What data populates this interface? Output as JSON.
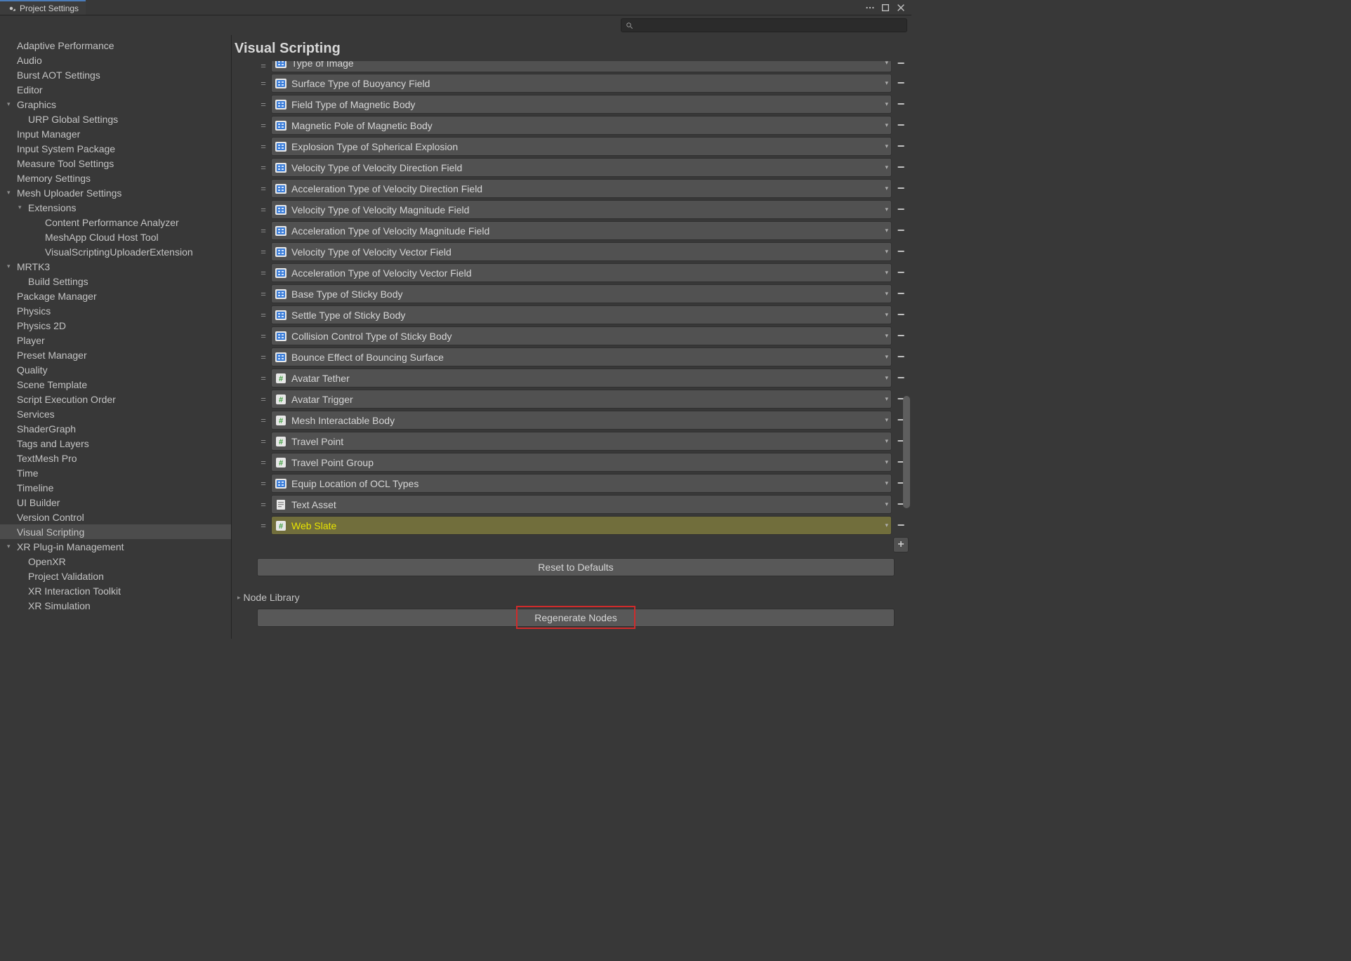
{
  "window": {
    "title": "Project Settings"
  },
  "search": {
    "placeholder": ""
  },
  "sidebar": {
    "items": [
      {
        "label": "Adaptive Performance",
        "indent": 0,
        "toggle": false
      },
      {
        "label": "Audio",
        "indent": 0,
        "toggle": false
      },
      {
        "label": "Burst AOT Settings",
        "indent": 0,
        "toggle": false
      },
      {
        "label": "Editor",
        "indent": 0,
        "toggle": false
      },
      {
        "label": "Graphics",
        "indent": 0,
        "toggle": true,
        "open": true
      },
      {
        "label": "URP Global Settings",
        "indent": 1,
        "toggle": false
      },
      {
        "label": "Input Manager",
        "indent": 0,
        "toggle": false
      },
      {
        "label": "Input System Package",
        "indent": 0,
        "toggle": false
      },
      {
        "label": "Measure Tool Settings",
        "indent": 0,
        "toggle": false
      },
      {
        "label": "Memory Settings",
        "indent": 0,
        "toggle": false
      },
      {
        "label": "Mesh Uploader Settings",
        "indent": 0,
        "toggle": true,
        "open": true
      },
      {
        "label": "Extensions",
        "indent": 1,
        "toggle": true,
        "open": true
      },
      {
        "label": "Content Performance Analyzer",
        "indent": 2,
        "toggle": false
      },
      {
        "label": "MeshApp Cloud Host Tool",
        "indent": 2,
        "toggle": false
      },
      {
        "label": "VisualScriptingUploaderExtension",
        "indent": 2,
        "toggle": false
      },
      {
        "label": "MRTK3",
        "indent": 0,
        "toggle": true,
        "open": true
      },
      {
        "label": "Build Settings",
        "indent": 1,
        "toggle": false
      },
      {
        "label": "Package Manager",
        "indent": 0,
        "toggle": false
      },
      {
        "label": "Physics",
        "indent": 0,
        "toggle": false
      },
      {
        "label": "Physics 2D",
        "indent": 0,
        "toggle": false
      },
      {
        "label": "Player",
        "indent": 0,
        "toggle": false
      },
      {
        "label": "Preset Manager",
        "indent": 0,
        "toggle": false
      },
      {
        "label": "Quality",
        "indent": 0,
        "toggle": false
      },
      {
        "label": "Scene Template",
        "indent": 0,
        "toggle": false
      },
      {
        "label": "Script Execution Order",
        "indent": 0,
        "toggle": false
      },
      {
        "label": "Services",
        "indent": 0,
        "toggle": false
      },
      {
        "label": "ShaderGraph",
        "indent": 0,
        "toggle": false
      },
      {
        "label": "Tags and Layers",
        "indent": 0,
        "toggle": false
      },
      {
        "label": "TextMesh Pro",
        "indent": 0,
        "toggle": false
      },
      {
        "label": "Time",
        "indent": 0,
        "toggle": false
      },
      {
        "label": "Timeline",
        "indent": 0,
        "toggle": false
      },
      {
        "label": "UI Builder",
        "indent": 0,
        "toggle": false
      },
      {
        "label": "Version Control",
        "indent": 0,
        "toggle": false
      },
      {
        "label": "Visual Scripting",
        "indent": 0,
        "toggle": false,
        "selected": true
      },
      {
        "label": "XR Plug-in Management",
        "indent": 0,
        "toggle": true,
        "open": true
      },
      {
        "label": "OpenXR",
        "indent": 1,
        "toggle": false
      },
      {
        "label": "Project Validation",
        "indent": 1,
        "toggle": false
      },
      {
        "label": "XR Interaction Toolkit",
        "indent": 1,
        "toggle": false
      },
      {
        "label": "XR Simulation",
        "indent": 1,
        "toggle": false
      }
    ]
  },
  "main": {
    "title": "Visual Scripting",
    "types": [
      {
        "label": "Type of Image",
        "icon": "enum",
        "clipped": true
      },
      {
        "label": "Surface Type of Buoyancy Field",
        "icon": "enum"
      },
      {
        "label": "Field Type of Magnetic Body",
        "icon": "enum"
      },
      {
        "label": "Magnetic Pole of Magnetic Body",
        "icon": "enum"
      },
      {
        "label": "Explosion Type of Spherical Explosion",
        "icon": "enum"
      },
      {
        "label": "Velocity Type of Velocity Direction Field",
        "icon": "enum"
      },
      {
        "label": "Acceleration Type of Velocity Direction Field",
        "icon": "enum"
      },
      {
        "label": "Velocity Type of Velocity Magnitude Field",
        "icon": "enum"
      },
      {
        "label": "Acceleration Type of Velocity Magnitude Field",
        "icon": "enum"
      },
      {
        "label": "Velocity Type of Velocity Vector Field",
        "icon": "enum"
      },
      {
        "label": "Acceleration Type of Velocity Vector Field",
        "icon": "enum"
      },
      {
        "label": "Base Type of Sticky Body",
        "icon": "enum"
      },
      {
        "label": "Settle Type of Sticky Body",
        "icon": "enum"
      },
      {
        "label": "Collision Control Type of Sticky Body",
        "icon": "enum"
      },
      {
        "label": "Bounce Effect of Bouncing Surface",
        "icon": "enum"
      },
      {
        "label": "Avatar Tether",
        "icon": "script"
      },
      {
        "label": "Avatar Trigger",
        "icon": "script"
      },
      {
        "label": "Mesh Interactable Body",
        "icon": "script"
      },
      {
        "label": "Travel Point",
        "icon": "script"
      },
      {
        "label": "Travel Point Group",
        "icon": "script"
      },
      {
        "label": "Equip Location of OCL Types",
        "icon": "enum"
      },
      {
        "label": "Text Asset",
        "icon": "text"
      },
      {
        "label": "Web Slate",
        "icon": "script",
        "highlight": true
      }
    ],
    "reset_label": "Reset to Defaults",
    "node_library_label": "Node Library",
    "regenerate_label": "Regenerate Nodes"
  }
}
